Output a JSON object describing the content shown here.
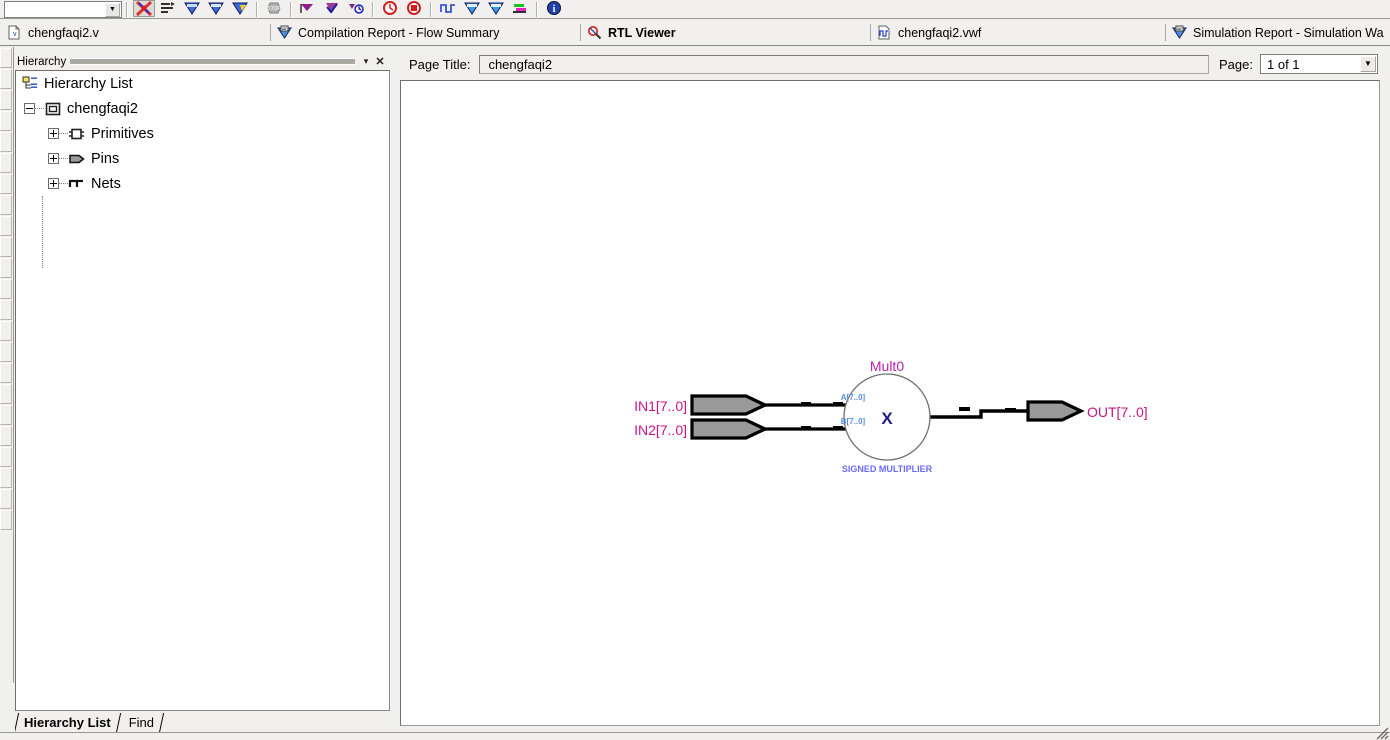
{
  "window": {
    "app": "Quartus II RTL Viewer"
  },
  "toolbar": {
    "combo_value": "",
    "buttons": [
      {
        "name": "compile-stop-icon",
        "glyph": "stop-x"
      },
      {
        "name": "assignment-editor-icon",
        "glyph": "assign"
      },
      {
        "name": "compile-design-icon",
        "glyph": "chip-blue"
      },
      {
        "name": "analysis-synthesis-icon",
        "glyph": "chip-blue"
      },
      {
        "name": "fitter-icon",
        "glyph": "chip-yellow"
      },
      {
        "name": "stop-processing-icon",
        "glyph": "stop-gray"
      },
      {
        "name": "programmer-icon",
        "glyph": "flag-purple"
      },
      {
        "name": "check-icon",
        "glyph": "check-purple"
      },
      {
        "name": "timing-analyzer-icon",
        "glyph": "clock"
      },
      {
        "name": "start-simulation-icon",
        "glyph": "clock-red"
      },
      {
        "name": "stop-simulation-icon",
        "glyph": "clock-red2"
      },
      {
        "name": "waveform-editor-icon",
        "glyph": "wave"
      },
      {
        "name": "rtl-viewer-icon",
        "glyph": "chip-blue"
      },
      {
        "name": "technology-map-icon",
        "glyph": "chip-blue"
      },
      {
        "name": "pin-planner-icon",
        "glyph": "pinplan"
      },
      {
        "name": "help-icon",
        "glyph": "help"
      }
    ]
  },
  "document_tabs": [
    {
      "label": "chengfaqi2.v",
      "icon": "verilog-file-icon",
      "active": false
    },
    {
      "label": "Compilation Report - Flow Summary",
      "icon": "report-icon",
      "active": false
    },
    {
      "label": "RTL Viewer",
      "icon": "rtl-viewer-icon",
      "active": true
    },
    {
      "label": "chengfaqi2.vwf",
      "icon": "waveform-file-icon",
      "active": false
    },
    {
      "label": "Simulation Report - Simulation Wa",
      "icon": "report-icon",
      "active": false
    }
  ],
  "hierarchy_panel": {
    "title": "Hierarchy",
    "dropdown_glyph": "▾",
    "close_glyph": "✕",
    "tree": [
      {
        "label": "Hierarchy List",
        "icon": "hierarchy-list-icon",
        "indent": 0,
        "expander": "none"
      },
      {
        "label": "chengfaqi2",
        "icon": "module-icon",
        "indent": 1,
        "expander": "minus"
      },
      {
        "label": "Primitives",
        "icon": "primitives-icon",
        "indent": 2,
        "expander": "plus"
      },
      {
        "label": "Pins",
        "icon": "pins-icon",
        "indent": 2,
        "expander": "plus"
      },
      {
        "label": "Nets",
        "icon": "nets-icon",
        "indent": 2,
        "expander": "plus"
      }
    ],
    "tabs": [
      {
        "label": "Hierarchy List",
        "active": true
      },
      {
        "label": "Find",
        "active": false
      }
    ]
  },
  "rtl_viewer": {
    "page_title_label": "Page Title:",
    "page_title_value": "chengfaqi2",
    "page_label": "Page:",
    "page_value": "1 of 1",
    "page_dropdown_glyph": "▼"
  },
  "schematic": {
    "instance_name": "Mult0",
    "instance_type": "SIGNED MULTIPLIER",
    "operator_symbol": "X",
    "inputs": [
      {
        "label": "IN1[7..0]",
        "port": "A[7..0]"
      },
      {
        "label": "IN2[7..0]",
        "port": "B[7..0]"
      }
    ],
    "outputs": [
      {
        "label": "OUT[7..0]"
      }
    ],
    "colors": {
      "pin_label": "#c71585",
      "instance_label": "#bb22aa",
      "port_label": "#5b8fe0",
      "type_label": "#6a6aff",
      "operator": "#202080",
      "pin_body": "#9a9a9a",
      "wire": "#000000"
    }
  }
}
